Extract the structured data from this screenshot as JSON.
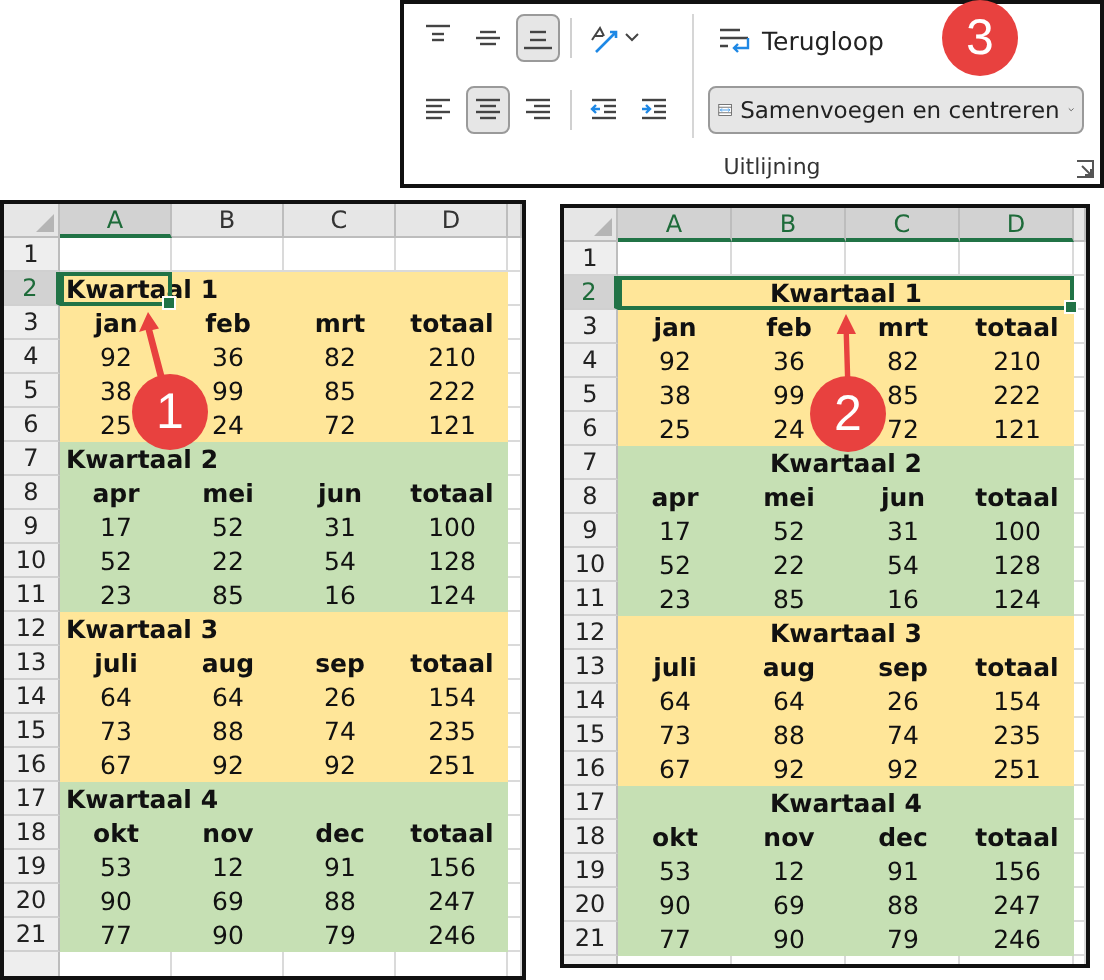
{
  "ribbon": {
    "icon_rows": [
      [
        {
          "kind": "align-top",
          "selected": false
        },
        {
          "kind": "align-middle",
          "selected": false
        },
        {
          "kind": "align-bottom",
          "selected": true
        },
        {
          "kind": "orientation",
          "selected": false
        }
      ],
      [
        {
          "kind": "align-left",
          "selected": false
        },
        {
          "kind": "align-center",
          "selected": true
        },
        {
          "kind": "align-right",
          "selected": false
        },
        {
          "kind": "indent-decrease",
          "selected": false
        },
        {
          "kind": "indent-increase",
          "selected": false
        }
      ]
    ],
    "wrap_text": {
      "label": "Terugloop"
    },
    "merge": {
      "label": "Samenvoegen en centreren"
    },
    "group_label": "Uitlijning"
  },
  "callouts": [
    {
      "label": "1"
    },
    {
      "label": "2"
    },
    {
      "label": "3"
    }
  ],
  "sheets": [
    {
      "merged": false,
      "columns": [
        {
          "label": "A",
          "selected": true
        },
        {
          "label": "B",
          "selected": false
        },
        {
          "label": "C",
          "selected": false
        },
        {
          "label": "D",
          "selected": false
        }
      ],
      "row_headers": [
        {
          "label": "1",
          "selected": false
        },
        {
          "label": "2",
          "selected": true
        },
        {
          "label": "3",
          "selected": false
        },
        {
          "label": "4",
          "selected": false
        },
        {
          "label": "5",
          "selected": false
        },
        {
          "label": "6",
          "selected": false
        },
        {
          "label": "7",
          "selected": false
        },
        {
          "label": "8",
          "selected": false
        },
        {
          "label": "9",
          "selected": false
        },
        {
          "label": "10",
          "selected": false
        },
        {
          "label": "11",
          "selected": false
        },
        {
          "label": "12",
          "selected": false
        },
        {
          "label": "13",
          "selected": false
        },
        {
          "label": "14",
          "selected": false
        },
        {
          "label": "15",
          "selected": false
        },
        {
          "label": "16",
          "selected": false
        },
        {
          "label": "17",
          "selected": false
        },
        {
          "label": "18",
          "selected": false
        },
        {
          "label": "19",
          "selected": false
        },
        {
          "label": "20",
          "selected": false
        },
        {
          "label": "21",
          "selected": false
        }
      ],
      "quarters": [
        {
          "title": "Kwartaal 1",
          "color": "#ffe699",
          "months": [
            "jan",
            "feb",
            "mrt",
            "totaal"
          ],
          "rows": [
            [
              "92",
              "36",
              "82",
              "210"
            ],
            [
              "38",
              "99",
              "85",
              "222"
            ],
            [
              "25",
              "24",
              "72",
              "121"
            ]
          ]
        },
        {
          "title": "Kwartaal 2",
          "color": "#c6e0b4",
          "months": [
            "apr",
            "mei",
            "jun",
            "totaal"
          ],
          "rows": [
            [
              "17",
              "52",
              "31",
              "100"
            ],
            [
              "52",
              "22",
              "54",
              "128"
            ],
            [
              "23",
              "85",
              "16",
              "124"
            ]
          ]
        },
        {
          "title": "Kwartaal 3",
          "color": "#ffe699",
          "months": [
            "juli",
            "aug",
            "sep",
            "totaal"
          ],
          "rows": [
            [
              "64",
              "64",
              "26",
              "154"
            ],
            [
              "73",
              "88",
              "74",
              "235"
            ],
            [
              "67",
              "92",
              "92",
              "251"
            ]
          ]
        },
        {
          "title": "Kwartaal 4",
          "color": "#c6e0b4",
          "months": [
            "okt",
            "nov",
            "dec",
            "totaal"
          ],
          "rows": [
            [
              "53",
              "12",
              "91",
              "156"
            ],
            [
              "90",
              "69",
              "88",
              "247"
            ],
            [
              "77",
              "90",
              "79",
              "246"
            ]
          ]
        }
      ]
    },
    {
      "merged": true,
      "columns": [
        {
          "label": "A",
          "selected": true
        },
        {
          "label": "B",
          "selected": true
        },
        {
          "label": "C",
          "selected": true
        },
        {
          "label": "D",
          "selected": true
        }
      ],
      "row_headers": [
        {
          "label": "1",
          "selected": false
        },
        {
          "label": "2",
          "selected": true
        },
        {
          "label": "3",
          "selected": false
        },
        {
          "label": "4",
          "selected": false
        },
        {
          "label": "5",
          "selected": false
        },
        {
          "label": "6",
          "selected": false
        },
        {
          "label": "7",
          "selected": false
        },
        {
          "label": "8",
          "selected": false
        },
        {
          "label": "9",
          "selected": false
        },
        {
          "label": "10",
          "selected": false
        },
        {
          "label": "11",
          "selected": false
        },
        {
          "label": "12",
          "selected": false
        },
        {
          "label": "13",
          "selected": false
        },
        {
          "label": "14",
          "selected": false
        },
        {
          "label": "15",
          "selected": false
        },
        {
          "label": "16",
          "selected": false
        },
        {
          "label": "17",
          "selected": false
        },
        {
          "label": "18",
          "selected": false
        },
        {
          "label": "19",
          "selected": false
        },
        {
          "label": "20",
          "selected": false
        },
        {
          "label": "21",
          "selected": false
        }
      ],
      "quarters": [
        {
          "title": "Kwartaal 1",
          "color": "#ffe699",
          "months": [
            "jan",
            "feb",
            "mrt",
            "totaal"
          ],
          "rows": [
            [
              "92",
              "36",
              "82",
              "210"
            ],
            [
              "38",
              "99",
              "85",
              "222"
            ],
            [
              "25",
              "24",
              "72",
              "121"
            ]
          ]
        },
        {
          "title": "Kwartaal 2",
          "color": "#c6e0b4",
          "months": [
            "apr",
            "mei",
            "jun",
            "totaal"
          ],
          "rows": [
            [
              "17",
              "52",
              "31",
              "100"
            ],
            [
              "52",
              "22",
              "54",
              "128"
            ],
            [
              "23",
              "85",
              "16",
              "124"
            ]
          ]
        },
        {
          "title": "Kwartaal 3",
          "color": "#ffe699",
          "months": [
            "juli",
            "aug",
            "sep",
            "totaal"
          ],
          "rows": [
            [
              "64",
              "64",
              "26",
              "154"
            ],
            [
              "73",
              "88",
              "74",
              "235"
            ],
            [
              "67",
              "92",
              "92",
              "251"
            ]
          ]
        },
        {
          "title": "Kwartaal 4",
          "color": "#c6e0b4",
          "months": [
            "okt",
            "nov",
            "dec",
            "totaal"
          ],
          "rows": [
            [
              "53",
              "12",
              "91",
              "156"
            ],
            [
              "90",
              "69",
              "88",
              "247"
            ],
            [
              "77",
              "90",
              "79",
              "246"
            ]
          ]
        }
      ]
    }
  ]
}
